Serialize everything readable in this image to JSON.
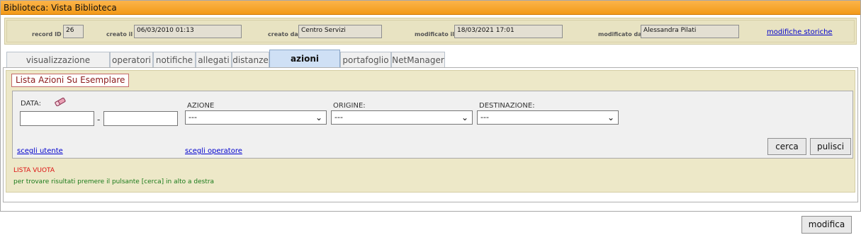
{
  "window": {
    "title": "Biblioteca: Vista Biblioteca"
  },
  "record": {
    "id_label": "record ID",
    "id_value": "26",
    "created_label": "creato il",
    "created_value": "06/03/2010 01:13",
    "created_by_label": "creato da",
    "created_by_value": "Centro Servizi",
    "modified_label": "modificato il",
    "modified_value": "18/03/2021 17:01",
    "modified_by_label": "modificato da",
    "modified_by_value": "Alessandra Pilati",
    "history_link": "modifiche storiche"
  },
  "tabs": [
    {
      "label": "visualizzazione biblioteca",
      "active": false
    },
    {
      "label": "operatori",
      "active": false
    },
    {
      "label": "notifiche",
      "active": false
    },
    {
      "label": "allegati",
      "active": false
    },
    {
      "label": "distanze",
      "active": false
    },
    {
      "label": "azioni storiche",
      "active": true
    },
    {
      "label": "portafoglio",
      "active": false
    },
    {
      "label": "NetManager",
      "active": false
    }
  ],
  "section": {
    "title": "Lista Azioni Su Esemplare"
  },
  "filters": {
    "date_label": "DATA:",
    "date_separator": "-",
    "date_from_value": "",
    "date_to_value": "",
    "eraser_icon": "eraser-icon",
    "action_label": "AZIONE",
    "action_value": "---",
    "origin_label": "ORIGINE:",
    "origin_value": "---",
    "destination_label": "DESTINAZIONE:",
    "destination_value": "---",
    "choose_user_link": "scegli utente",
    "choose_operator_link": "scegli operatore",
    "search_button": "cerca",
    "clear_button": "pulisci"
  },
  "results": {
    "empty_title": "LISTA VUOTA",
    "empty_hint": "per trovare risultati premere il pulsante [cerca] in alto a destra"
  },
  "footer": {
    "modify_button": "modifica"
  },
  "colors": {
    "titlebar": "#f39a18",
    "panel_bg": "#ede8c8",
    "active_tab": "#cfe0f5",
    "empty_title": "#dd1111",
    "empty_hint": "#1a7a1a",
    "link": "#0000cc"
  }
}
